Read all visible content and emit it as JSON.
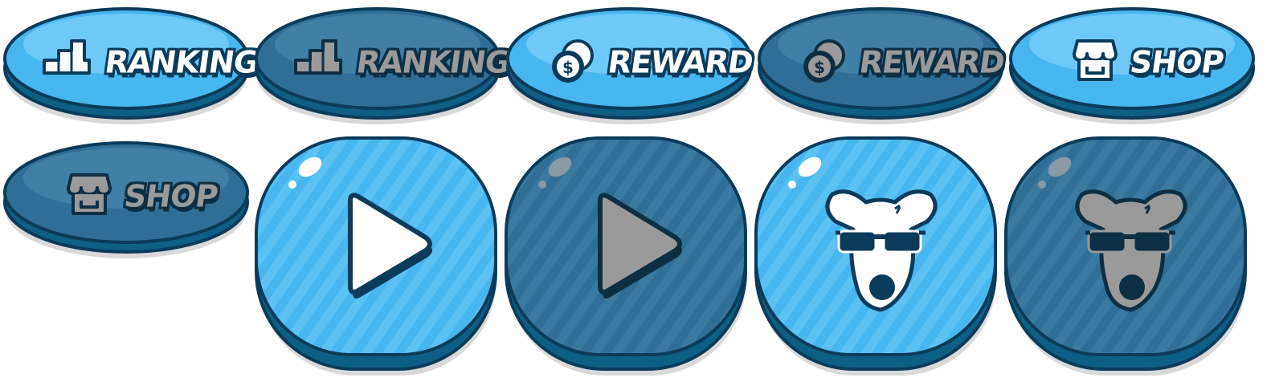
{
  "colors": {
    "active_fill": "#48b6ef",
    "active_highlight": "#8fd8ff",
    "inactive_fill": "#2f6f97",
    "inactive_highlight": "#4d8bb0",
    "outline": "#0b3b5a",
    "base_shadow": "#0e5f86",
    "icon_inactive": "#9a9a9a"
  },
  "buttons": [
    {
      "label": "RANKING",
      "icon": "podium-icon",
      "state": "active"
    },
    {
      "label": "RANKING",
      "icon": "podium-icon",
      "state": "inactive"
    },
    {
      "label": "REWARD",
      "icon": "coin-icon",
      "state": "active"
    },
    {
      "label": "REWARD",
      "icon": "coin-icon",
      "state": "inactive"
    },
    {
      "label": "SHOP",
      "icon": "shop-icon",
      "state": "active"
    },
    {
      "label": "SHOP",
      "icon": "shop-icon",
      "state": "inactive"
    }
  ],
  "icon_buttons": [
    {
      "icon": "play-icon",
      "state": "active"
    },
    {
      "icon": "play-icon",
      "state": "inactive"
    },
    {
      "icon": "dog-sunglasses-icon",
      "state": "active"
    },
    {
      "icon": "dog-sunglasses-icon",
      "state": "inactive"
    }
  ]
}
